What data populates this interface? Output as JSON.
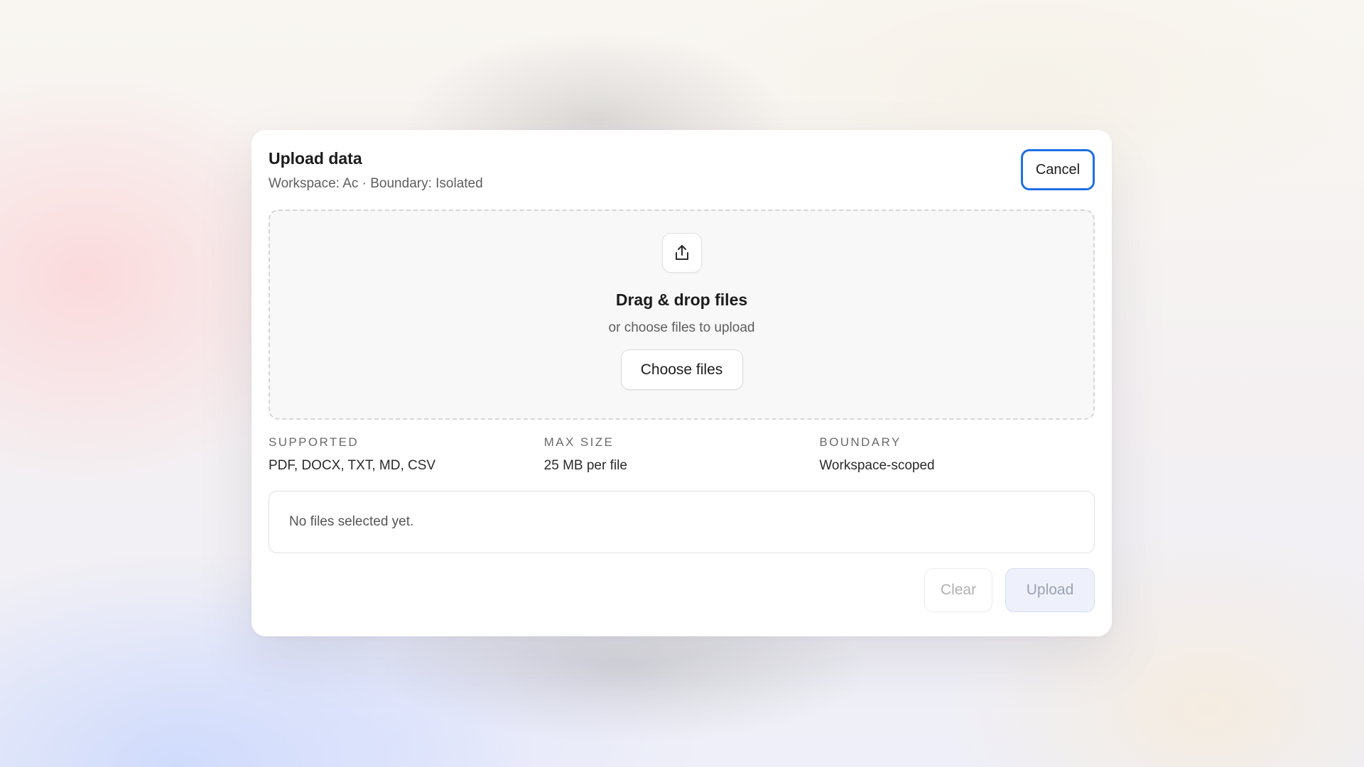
{
  "dialog": {
    "title": "Upload data",
    "subtitle": "Workspace: Ac · Boundary: Isolated",
    "cancel_label": "Cancel"
  },
  "dropzone": {
    "icon": "upload-icon",
    "title": "Drag & drop files",
    "subtitle": "or choose files to upload",
    "choose_label": "Choose files"
  },
  "info": [
    {
      "label": "SUPPORTED",
      "value": "PDF, DOCX, TXT, MD, CSV"
    },
    {
      "label": "MAX SIZE",
      "value": "25 MB per file"
    },
    {
      "label": "BOUNDARY",
      "value": "Workspace-scoped"
    }
  ],
  "file_list": {
    "empty_text": "No files selected yet."
  },
  "footer": {
    "clear_label": "Clear",
    "upload_label": "Upload",
    "clear_disabled": true,
    "upload_disabled": true
  },
  "colors": {
    "accent": "#1f6fe5",
    "upload_disabled_bg": "#eef1fb"
  }
}
